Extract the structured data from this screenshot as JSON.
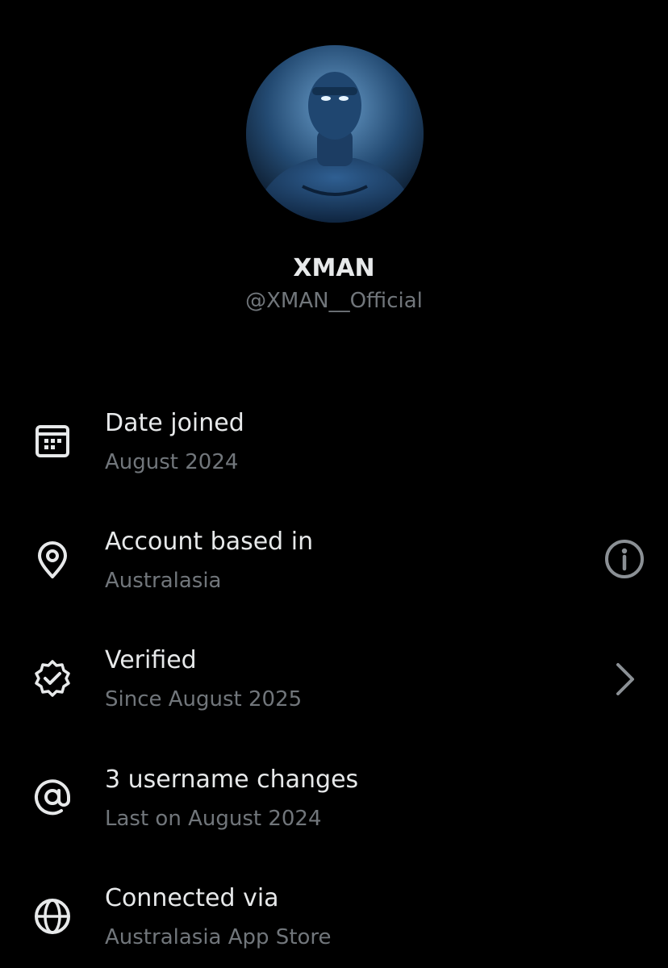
{
  "profile": {
    "display_name": "XMAN",
    "handle": "@XMAN__Official"
  },
  "rows": [
    {
      "icon": "calendar-icon",
      "title": "Date joined",
      "subtitle": "August 2024"
    },
    {
      "icon": "location-pin-icon",
      "title": "Account based in",
      "subtitle": "Australasia",
      "action_icon": "info-icon"
    },
    {
      "icon": "verified-badge-icon",
      "title": "Verified",
      "subtitle": "Since August 2025",
      "action_icon": "chevron-right-icon"
    },
    {
      "icon": "at-sign-icon",
      "title": "3 username changes",
      "subtitle": "Last on August 2024"
    },
    {
      "icon": "globe-icon",
      "title": "Connected via",
      "subtitle": "Australasia App Store"
    }
  ],
  "colors": {
    "background": "#000000",
    "primary_text": "#e7e9ea",
    "secondary_text": "#71767b"
  }
}
